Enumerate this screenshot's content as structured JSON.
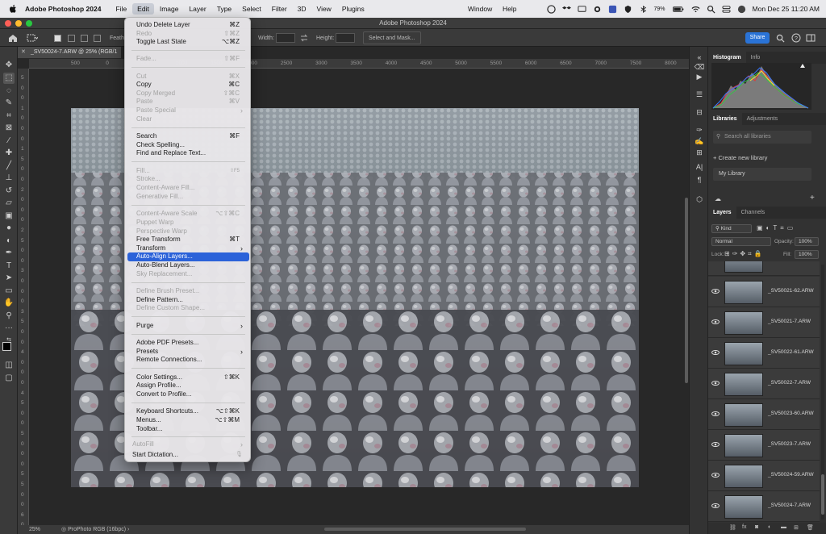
{
  "menubar": {
    "app_name": "Adobe Photoshop 2024",
    "menus": [
      "File",
      "Edit",
      "Image",
      "Layer",
      "Type",
      "Select",
      "Filter",
      "3D",
      "View",
      "Plugins"
    ],
    "right_menus": [
      "Window",
      "Help"
    ],
    "battery": "79%",
    "clock": "Mon Dec 25  11:20 AM"
  },
  "window": {
    "title": "Adobe Photoshop 2024"
  },
  "options_bar": {
    "feather_label": "Feath",
    "width_label": "Width:",
    "height_label": "Height:",
    "select_mask_label": "Select and Mask...",
    "share_label": "Share"
  },
  "document": {
    "tab_title": "_SV50024-7.ARW @ 25% (RGB/1",
    "zoom": "25%",
    "color_profile": "ProPhoto RGB (16bpc)",
    "h_ruler_labels": [
      "500",
      "0",
      "500",
      "1000",
      "1500",
      "2000",
      "2500",
      "3000",
      "3500",
      "4000",
      "4500",
      "5000",
      "5500",
      "6000",
      "6500",
      "7000",
      "7500",
      "8000",
      "8500",
      "9000"
    ],
    "v_ruler_labels": [
      "5",
      "0",
      "0",
      "1",
      "0",
      "0",
      "0",
      "1",
      "5",
      "0",
      "0",
      "2",
      "0",
      "0",
      "0",
      "2",
      "5",
      "0",
      "0",
      "3",
      "0",
      "0",
      "0",
      "3",
      "5",
      "0",
      "0",
      "4",
      "0",
      "0",
      "0",
      "4",
      "5",
      "0",
      "0",
      "5",
      "0",
      "0",
      "0",
      "5",
      "5",
      "0",
      "0",
      "6",
      "0",
      "0",
      "0"
    ]
  },
  "edit_menu": {
    "items": [
      {
        "label": "Undo Delete Layer",
        "shortcut": "⌘Z",
        "enabled": true
      },
      {
        "label": "Redo",
        "shortcut": "⇧⌘Z",
        "enabled": false
      },
      {
        "label": "Toggle Last State",
        "shortcut": "⌥⌘Z",
        "enabled": true
      },
      {
        "label": "Fade...",
        "shortcut": "⇧⌘F",
        "enabled": false
      },
      {
        "label": "Cut",
        "shortcut": "⌘X",
        "enabled": false
      },
      {
        "label": "Copy",
        "shortcut": "⌘C",
        "enabled": true
      },
      {
        "label": "Copy Merged",
        "shortcut": "⇧⌘C",
        "enabled": false
      },
      {
        "label": "Paste",
        "shortcut": "⌘V",
        "enabled": false
      },
      {
        "label": "Paste Special",
        "shortcut": "",
        "enabled": false
      },
      {
        "label": "Clear",
        "shortcut": "",
        "enabled": false
      },
      {
        "label": "Search",
        "shortcut": "⌘F",
        "enabled": true
      },
      {
        "label": "Check Spelling...",
        "shortcut": "",
        "enabled": true
      },
      {
        "label": "Find and Replace Text...",
        "shortcut": "",
        "enabled": true
      },
      {
        "label": "Fill...",
        "shortcut": "⇧F5",
        "enabled": false
      },
      {
        "label": "Stroke...",
        "shortcut": "",
        "enabled": false
      },
      {
        "label": "Content-Aware Fill...",
        "shortcut": "",
        "enabled": false
      },
      {
        "label": "Generative Fill...",
        "shortcut": "",
        "enabled": false
      },
      {
        "label": "Content-Aware Scale",
        "shortcut": "⌥⇧⌘C",
        "enabled": false
      },
      {
        "label": "Puppet Warp",
        "shortcut": "",
        "enabled": false
      },
      {
        "label": "Perspective Warp",
        "shortcut": "",
        "enabled": false
      },
      {
        "label": "Free Transform",
        "shortcut": "⌘T",
        "enabled": true
      },
      {
        "label": "Transform",
        "shortcut": "",
        "enabled": true
      },
      {
        "label": "Auto-Align Layers...",
        "shortcut": "",
        "enabled": true
      },
      {
        "label": "Auto-Blend Layers...",
        "shortcut": "",
        "enabled": true
      },
      {
        "label": "Sky Replacement...",
        "shortcut": "",
        "enabled": false
      },
      {
        "label": "Define Brush Preset...",
        "shortcut": "",
        "enabled": false
      },
      {
        "label": "Define Pattern...",
        "shortcut": "",
        "enabled": true
      },
      {
        "label": "Define Custom Shape...",
        "shortcut": "",
        "enabled": false
      },
      {
        "label": "Purge",
        "shortcut": "",
        "enabled": true
      },
      {
        "label": "Adobe PDF Presets...",
        "shortcut": "",
        "enabled": true
      },
      {
        "label": "Presets",
        "shortcut": "",
        "enabled": true
      },
      {
        "label": "Remote Connections...",
        "shortcut": "",
        "enabled": true
      },
      {
        "label": "Color Settings...",
        "shortcut": "⇧⌘K",
        "enabled": true
      },
      {
        "label": "Assign Profile...",
        "shortcut": "",
        "enabled": true
      },
      {
        "label": "Convert to Profile...",
        "shortcut": "",
        "enabled": true
      },
      {
        "label": "Keyboard Shortcuts...",
        "shortcut": "⌥⇧⌘K",
        "enabled": true
      },
      {
        "label": "Menus...",
        "shortcut": "⌥⇧⌘M",
        "enabled": true
      },
      {
        "label": "Toolbar...",
        "shortcut": "",
        "enabled": true
      },
      {
        "label": "AutoFill",
        "shortcut": "",
        "enabled": false
      },
      {
        "label": "Start Dictation...",
        "shortcut": "",
        "enabled": true
      }
    ]
  },
  "panels": {
    "top_tabs": [
      "Histogram",
      "Info"
    ],
    "mid_tabs": [
      "Libraries",
      "Adjustments"
    ],
    "search_placeholder": "Search all libraries",
    "create_library": "Create new library",
    "my_library": "My Library",
    "layers_tabs": [
      "Layers",
      "Channels"
    ],
    "kind_filter": "Kind",
    "blend_mode": "Normal",
    "opacity_label": "Opacity:",
    "opacity_value": "100%",
    "lock_label": "Lock:",
    "fill_label": "Fill:",
    "fill_value": "100%",
    "layers": [
      "_SV50021-62.ARW",
      "_SV50021-7.ARW",
      "_SV50022-61.ARW",
      "_SV50022-7.ARW",
      "_SV50023-60.ARW",
      "_SV50023-7.ARW",
      "_SV50024-59.ARW",
      "_SV50024-7.ARW"
    ]
  }
}
